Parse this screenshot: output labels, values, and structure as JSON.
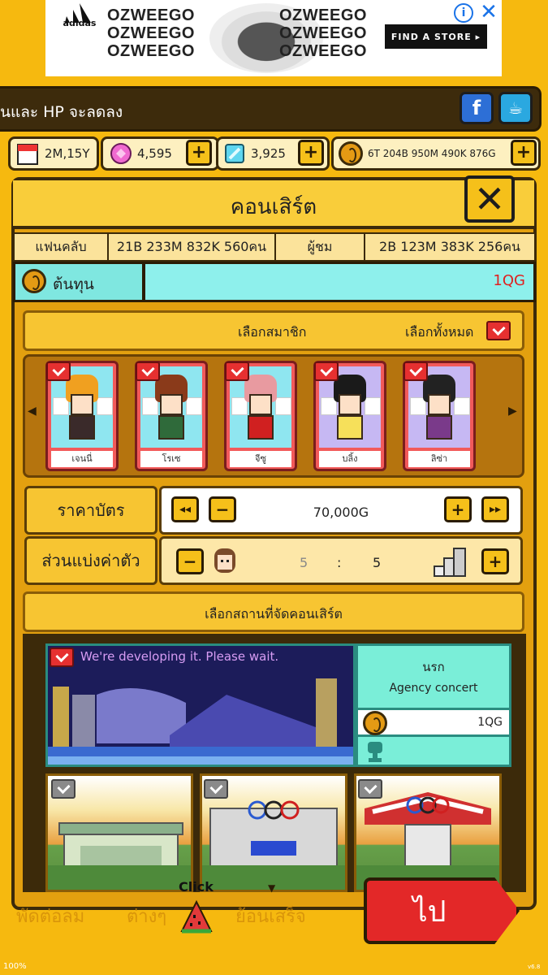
{
  "ad": {
    "brand": "adidas",
    "lines_left": [
      "OZWEEGO",
      "OZWEEGO",
      "OZWEEGO"
    ],
    "lines_right": [
      "OZWEEGO",
      "OZWEEGO",
      "OZWEEGO"
    ],
    "cta": "FIND A STORE",
    "info_glyph": "i",
    "close_glyph": "✕"
  },
  "ticker": {
    "text": "นและ HP จะลดลง",
    "facebook_glyph": "f",
    "community_glyph": "☕"
  },
  "resources": {
    "date": "2M,15Y",
    "gems_pink": "4,595",
    "gems_blue": "3,925",
    "gold": "6T 204B 950M 490K 876G",
    "plus_glyph": "+"
  },
  "panel": {
    "title": "คอนเสิร์ต",
    "close_glyph": "✕",
    "fanclub_label": "แฟนคลับ",
    "fanclub_value": "21B 233M 832K 560คน",
    "viewers_label": "ผู้ชม",
    "viewers_value": "2B 123M 383K 256คน",
    "cost_label": "ต้นทุน",
    "cost_value": "1QG"
  },
  "members": {
    "header": "เลือกสมาชิก",
    "select_all": "เลือกทั้งหมด",
    "left_arrow": "◀",
    "right_arrow": "▶",
    "cards": [
      {
        "name": "เจนนี่",
        "hair": "#f0a020",
        "body": "#3a2a2a"
      },
      {
        "name": "โรเซ",
        "hair": "#8a3a1a",
        "body": "#2f6a3a"
      },
      {
        "name": "จีซู",
        "hair": "#e89aa0",
        "body": "#d02020"
      },
      {
        "name": "บลิ้ง",
        "hair": "#1a1a1a",
        "body": "#f6e05a"
      },
      {
        "name": "ลิซ่า",
        "hair": "#222222",
        "body": "#7a3a8a"
      }
    ]
  },
  "ticket": {
    "label": "ราคาบัตร",
    "value": "70,000G",
    "ff_minus": "◂◂",
    "minus": "−",
    "plus": "+",
    "ff_plus": "▸▸"
  },
  "share": {
    "label": "ส่วนแบ่งค่าตัว",
    "left": "5",
    "sep": ":",
    "right": "5",
    "minus": "−",
    "plus": "+"
  },
  "venue": {
    "header": "เลือกสถานที่จัดคอนเสิร์ต",
    "notice": "We're developing it. Please wait.",
    "name": "นรก",
    "subtitle": "Agency concert",
    "cost": "1QG"
  },
  "footer": {
    "click_hint": "Click",
    "go": "ไป",
    "tab1": "พัดต่อลม",
    "tab2": "ต่างๆ",
    "tab3": "ย้อนเสร็จ",
    "zoom": "100%",
    "version": "v6.8"
  },
  "colors": {
    "background": "#f6b90f",
    "panel": "#e3a00f",
    "go_button": "#e32828",
    "check": "#e63030",
    "cost_bar": "#8ef0ec"
  }
}
